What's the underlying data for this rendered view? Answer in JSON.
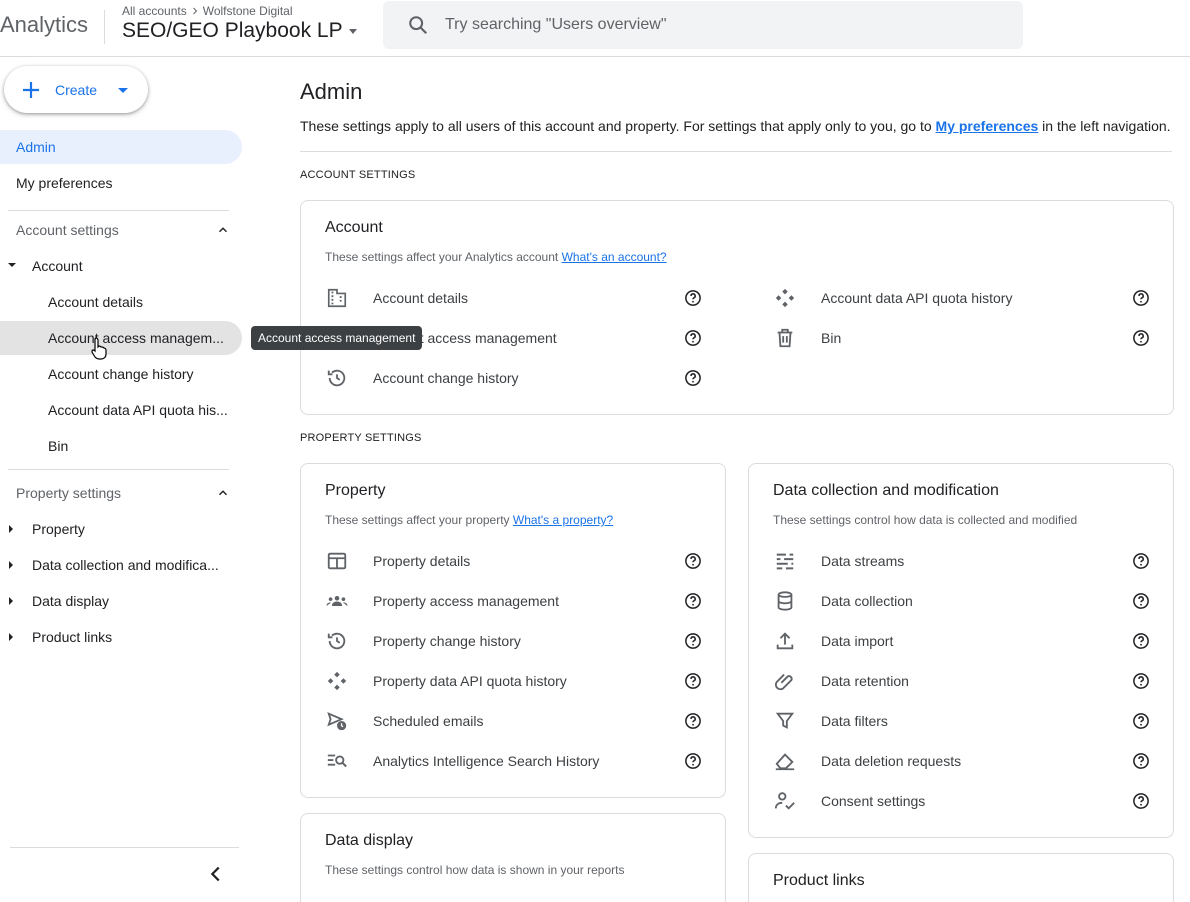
{
  "header": {
    "app_name": "Analytics",
    "breadcrumb_all": "All accounts",
    "breadcrumb_account": "Wolfstone Digital",
    "property_name": "SEO/GEO Playbook LP",
    "search_placeholder": "Try searching \"Users overview\""
  },
  "sidebar": {
    "create_label": "Create",
    "admin": "Admin",
    "my_preferences": "My preferences",
    "account_settings": "Account settings",
    "account": "Account",
    "account_items": [
      "Account details",
      "Account access managem...",
      "Account change history",
      "Account data API quota his...",
      "Bin"
    ],
    "property_settings": "Property settings",
    "property_items": [
      "Property",
      "Data collection and modifica...",
      "Data display",
      "Product links"
    ]
  },
  "tooltip": "Account access management",
  "main": {
    "title": "Admin",
    "desc_prefix": "These settings apply to all users of this account and property. For settings that apply only to you, go to ",
    "desc_link": "My preferences",
    "desc_suffix": " in the left navigation.",
    "account_settings_heading": "ACCOUNT SETTINGS",
    "property_settings_heading": "PROPERTY SETTINGS",
    "account_card": {
      "title": "Account",
      "sub_prefix": "These settings affect your Analytics account ",
      "sub_link": "What's an account?",
      "left": [
        "Account details",
        "Account access management",
        "Account change history"
      ],
      "right": [
        "Account data API quota history",
        "Bin"
      ]
    },
    "property_card": {
      "title": "Property",
      "sub_prefix": "These settings affect your property ",
      "sub_link": "What's a property?",
      "items": [
        "Property details",
        "Property access management",
        "Property change history",
        "Property data API quota history",
        "Scheduled emails",
        "Analytics Intelligence Search History"
      ]
    },
    "data_collection_card": {
      "title": "Data collection and modification",
      "sub": "These settings control how data is collected and modified",
      "items": [
        "Data streams",
        "Data collection",
        "Data import",
        "Data retention",
        "Data filters",
        "Data deletion requests",
        "Consent settings"
      ]
    },
    "data_display_card": {
      "title": "Data display",
      "sub": "These settings control how data is shown in your reports"
    },
    "product_links_card": {
      "title": "Product links"
    }
  },
  "colors": {
    "accent": "#1a73e8",
    "active_bg": "#e8f0fe",
    "border": "#dadce0"
  }
}
